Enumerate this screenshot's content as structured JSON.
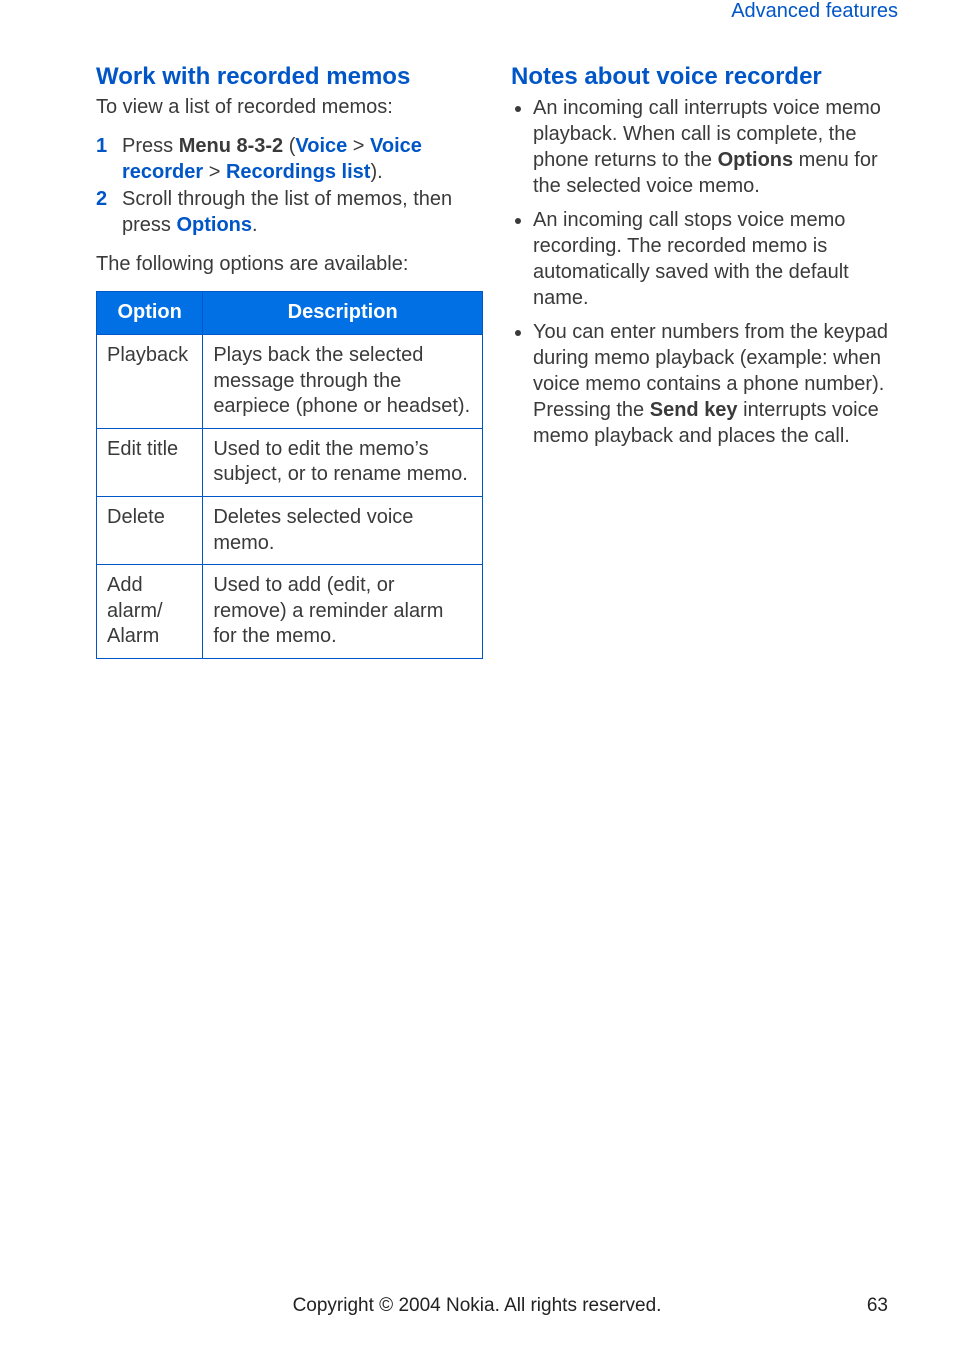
{
  "header": {
    "region": "Advanced features"
  },
  "left": {
    "heading": "Work with recorded memos",
    "intro": "To view a list of recorded memos:",
    "steps": [
      {
        "n": "1",
        "pre": "Press ",
        "menu": "Menu 8-3-2",
        "open": " (",
        "p1": "Voice",
        "sep1": " > ",
        "p2": "Voice recorder",
        "sep2": " > ",
        "p3": "Recordings list",
        "close": ")."
      },
      {
        "n": "2",
        "pre": "Scroll through the list of memos, then press ",
        "opt": "Options",
        "post": "."
      }
    ],
    "avail": "The following options are available:",
    "table": {
      "head": {
        "c1": "Option",
        "c2": "Description"
      },
      "rows": [
        {
          "opt": "Playback",
          "desc": "Plays back the selected message through the earpiece (phone or headset)."
        },
        {
          "opt": "Edit title",
          "desc": "Used to edit the memo’s subject, or to rename memo."
        },
        {
          "opt": "Delete",
          "desc": "Deletes selected voice memo."
        },
        {
          "opt": "Add alarm/\nAlarm",
          "desc": "Used to add (edit, or remove) a reminder alarm for the memo."
        }
      ]
    }
  },
  "right": {
    "heading": "Notes about voice recorder",
    "bullets": [
      {
        "t1": "An incoming call interrupts voice memo playback. When call is complete, the phone returns to the ",
        "b": "Options",
        "t2": " menu for the selected voice memo."
      },
      {
        "t1": "An incoming call stops voice memo recording. The recorded memo is automatically saved with the default name.",
        "b": "",
        "t2": ""
      },
      {
        "t1": "You can enter numbers from the keypad during memo playback (example: when voice memo contains a phone number). Pressing the ",
        "b": "Send key",
        "t2": " interrupts voice memo playback and places the call."
      }
    ]
  },
  "footer": {
    "copyright": "Copyright © 2004 Nokia. All rights reserved.",
    "page": "63"
  }
}
